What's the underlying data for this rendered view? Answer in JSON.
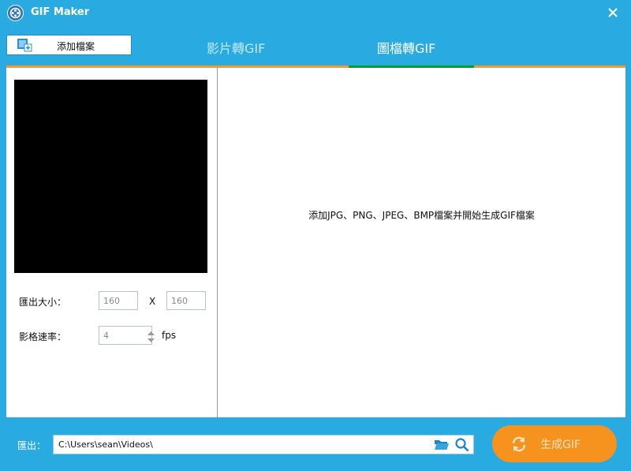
{
  "window": {
    "title": "GIF Maker"
  },
  "toolbar": {
    "add_file_label": "添加檔案"
  },
  "tabs": [
    {
      "label": "影片轉GIF",
      "active": false
    },
    {
      "label": "圖檔轉GIF",
      "active": true
    }
  ],
  "settings": {
    "output_size_label": "匯出大小：",
    "width": "160",
    "times": "X",
    "height": "160",
    "frame_rate_label": "影格速率：",
    "frame_rate": "4",
    "fps_unit": "fps"
  },
  "drop_hint": "添加JPG、PNG、JPEG、BMP檔案并開始生成GIF檔案",
  "output": {
    "label": "匯出：",
    "path": "C:\\Users\\sean\\Videos\\"
  },
  "generate_button": {
    "label": "生成GIF"
  },
  "colors": {
    "window_bg": "#29abe2",
    "orange_accent": "#f49834",
    "green_accent": "#0a9a3a",
    "generate_button": "#f6921e"
  },
  "icons": [
    "app-logo-icon",
    "close-icon",
    "add-file-icon",
    "refresh-icon",
    "folder-icon",
    "search-icon",
    "spinner-up-icon",
    "spinner-down-icon"
  ]
}
